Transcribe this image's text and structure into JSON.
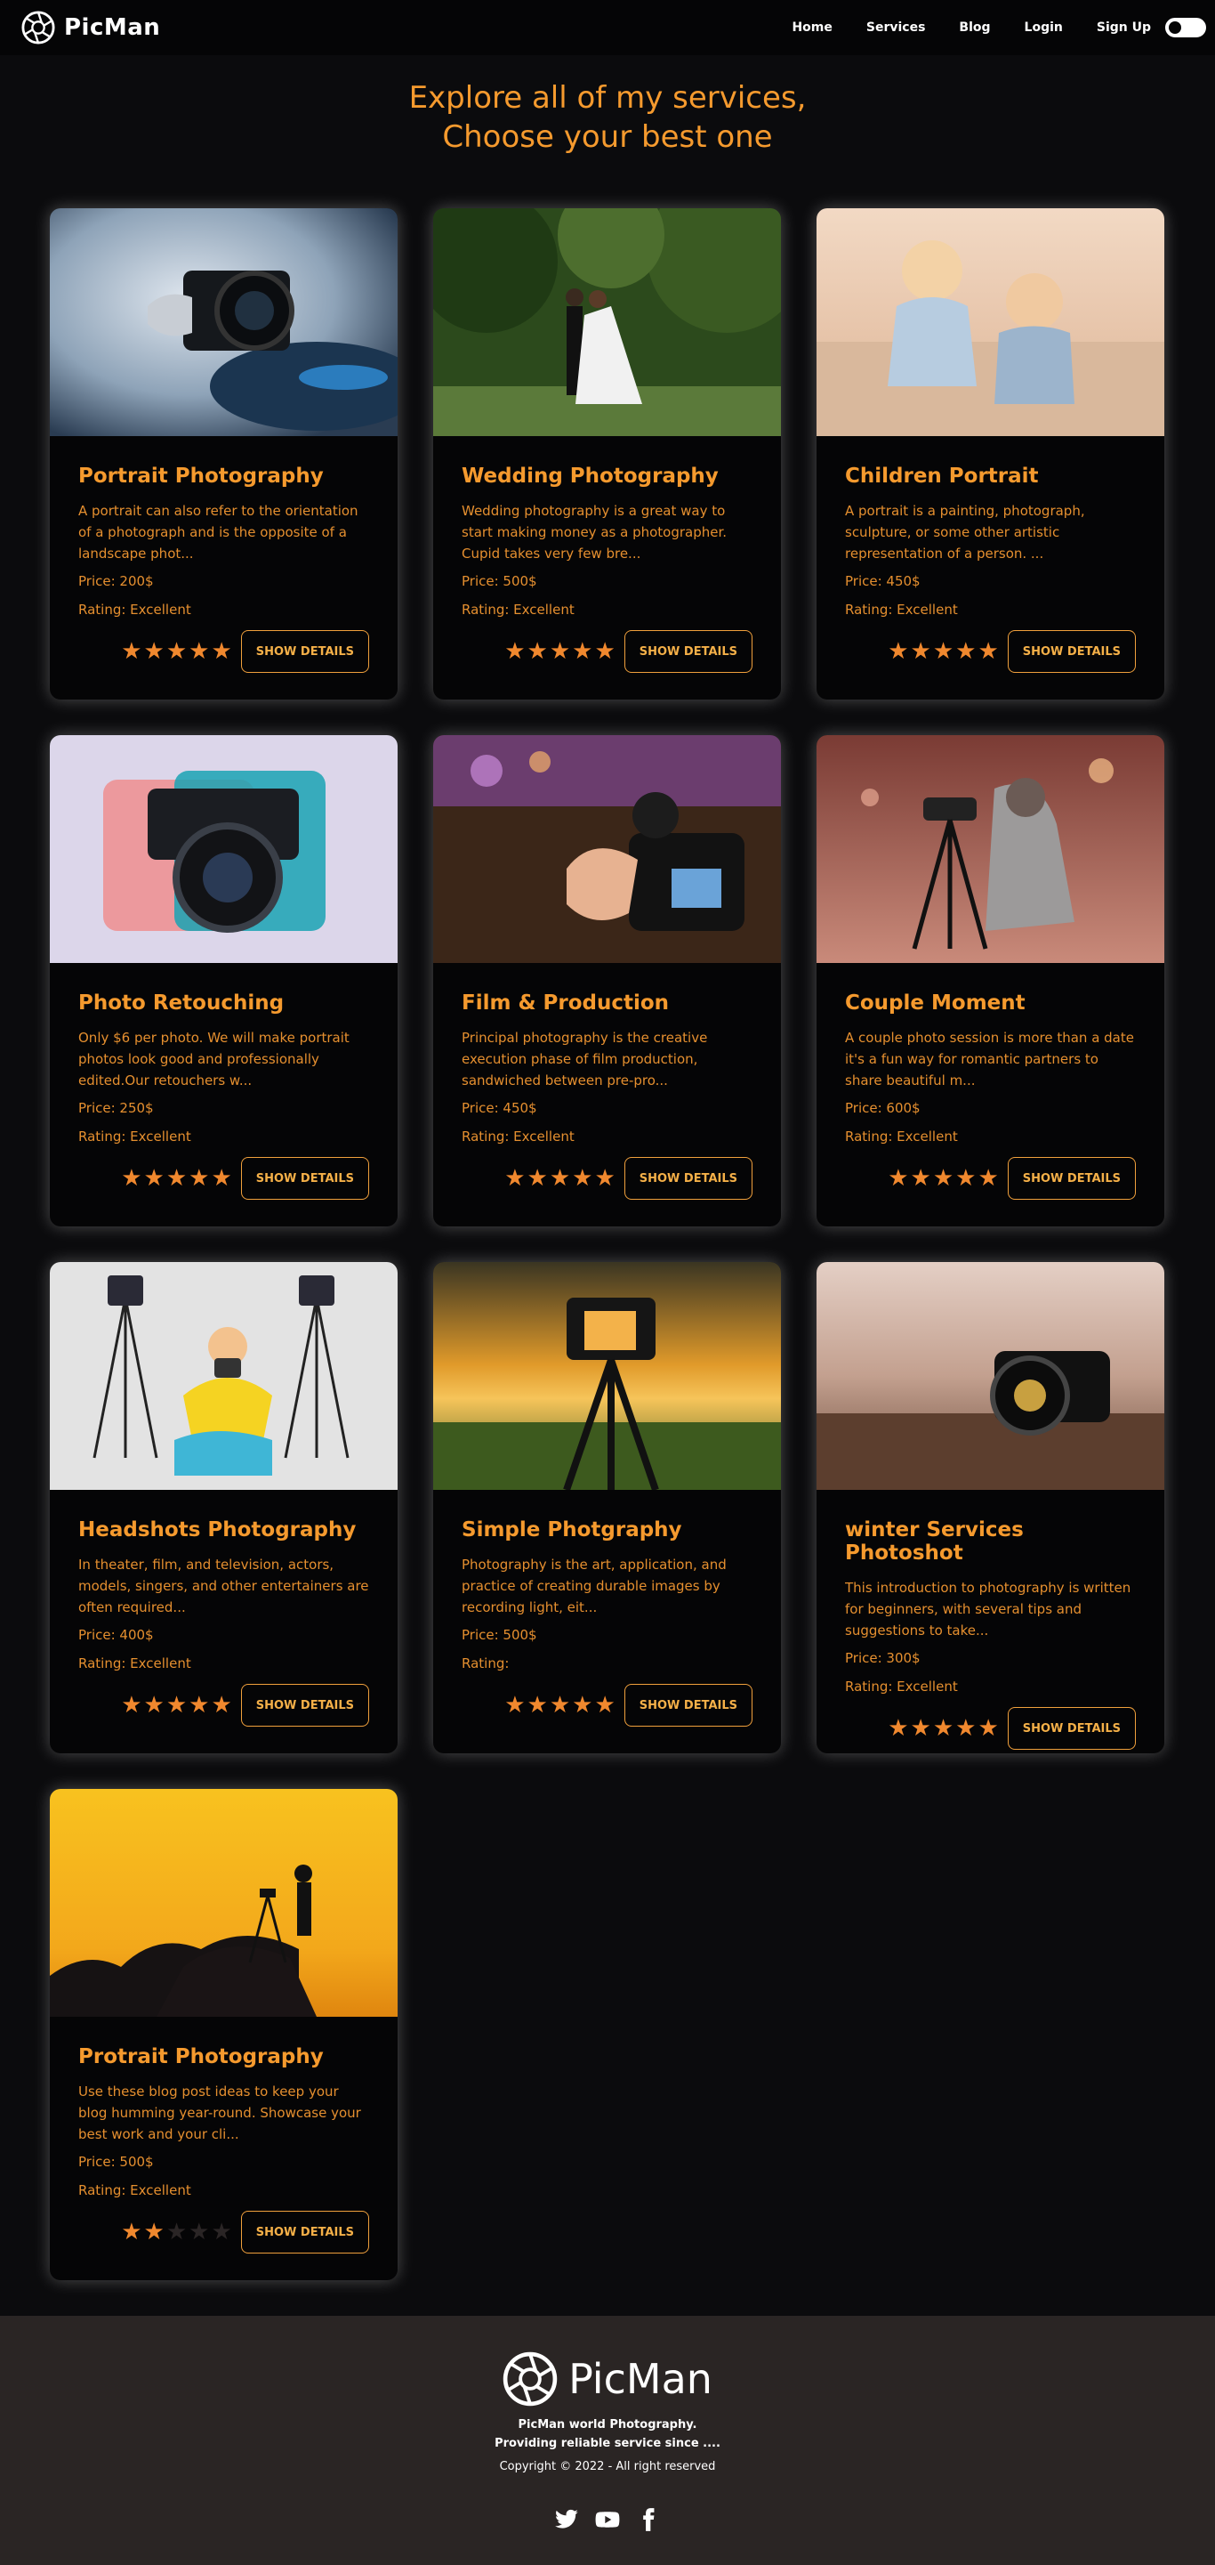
{
  "nav": {
    "brand": "PicMan",
    "links": [
      "Home",
      "Services",
      "Blog",
      "Login",
      "Sign Up"
    ]
  },
  "hero": {
    "line1": "Explore all of my services,",
    "line2": "Choose your best one"
  },
  "button_label": "SHOW DETAILS",
  "cards": [
    {
      "title": "Portrait Photography",
      "desc": "A portrait can also refer to the orientation of a photograph and is the opposite of a landscape phot...",
      "price": "Price: 200$",
      "rating": "Rating: Excellent",
      "stars": 5,
      "image": "camera-smoke"
    },
    {
      "title": "Wedding Photography",
      "desc": "Wedding photography is a great way to start making money as a photographer. Cupid takes very few bre...",
      "price": "Price: 500$",
      "rating": "Rating: Excellent",
      "stars": 5,
      "image": "wedding-couple"
    },
    {
      "title": "Children Portrait",
      "desc": "A portrait is a painting, photograph, sculpture, or some other artistic representation of a person. ...",
      "price": "Price: 450$",
      "rating": "Rating: Excellent",
      "stars": 5,
      "image": "children-beach"
    },
    {
      "title": "Photo Retouching",
      "desc": "Only $6 per photo. We will make portrait photos look good and professionally edited.Our retouchers w...",
      "price": "Price: 250$",
      "rating": "Rating: Excellent",
      "stars": 5,
      "image": "retro-camera"
    },
    {
      "title": "Film & Production",
      "desc": "Principal photography is the creative execution phase of film production, sandwiched between pre-pro...",
      "price": "Price: 450$",
      "rating": "Rating: Excellent",
      "stars": 5,
      "image": "film-camera"
    },
    {
      "title": "Couple Moment",
      "desc": "A couple photo session is more than a date it's a fun way for romantic partners to share beautiful m...",
      "price": "Price: 600$",
      "rating": "Rating: Excellent",
      "stars": 5,
      "image": "tripod-woman"
    },
    {
      "title": "Headshots Photography",
      "desc": "In theater, film, and television, actors, models, singers, and other entertainers are often required...",
      "price": "Price: 400$",
      "rating": "Rating: Excellent",
      "stars": 5,
      "image": "studio-illustration"
    },
    {
      "title": "Simple Photgraphy",
      "desc": "Photography is the art, application, and practice of creating durable images by recording light, eit...",
      "price": "Price: 500$",
      "rating": "Rating:",
      "stars": 5,
      "image": "sunset-tripod"
    },
    {
      "title": "winter Services Photoshot",
      "desc": "This introduction to photography is written for beginners, with several tips and suggestions to take...",
      "price": "Price: 300$",
      "rating": "Rating: Excellent",
      "stars": 5,
      "image": "camera-ground"
    },
    {
      "title": "Protrait Photography",
      "desc": "Use these blog post ideas to keep your blog humming year-round. Showcase your best work and your cli...",
      "price": "Price: 500$",
      "rating": "Rating: Excellent",
      "stars": 2,
      "image": "silhouette-sunset"
    }
  ],
  "footer": {
    "brand": "PicMan",
    "tagline1": "PicMan world Photography.",
    "tagline2": "Providing reliable service since ....",
    "copyright": "Copyright © 2022 - All right reserved",
    "socials": [
      "twitter-icon",
      "youtube-icon",
      "facebook-icon"
    ]
  }
}
